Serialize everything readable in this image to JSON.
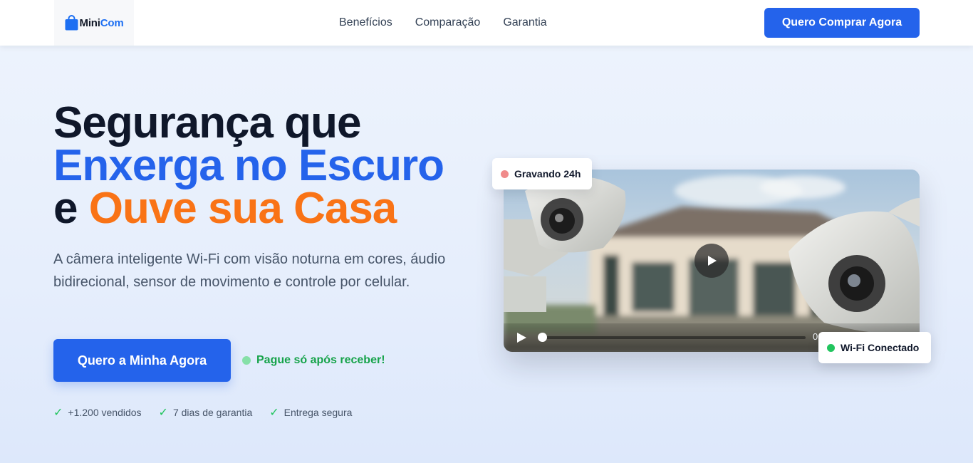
{
  "brand": {
    "name_part1": "Mini",
    "name_part2": "Com",
    "icon": "shopping-bag-icon",
    "color": "#1d6ff2"
  },
  "nav": {
    "items": [
      {
        "label": "Benefícios"
      },
      {
        "label": "Comparação"
      },
      {
        "label": "Garantia"
      }
    ],
    "cta_label": "Quero Comprar Agora"
  },
  "hero": {
    "headline_line1": "Segurança que",
    "headline_line2": "Enxerga no Escuro",
    "headline_line3_prefix": "e ",
    "headline_line3_highlight": "Ouve sua Casa",
    "subtext": "A câmera inteligente Wi-Fi com visão noturna em cores, áudio bidirecional, sensor de movimento e controle por celular.",
    "cta_label": "Quero a Minha Agora",
    "pay_note": "Pague só após receber!",
    "trust": [
      {
        "icon": "check-icon",
        "label": "+1.200 vendidos"
      },
      {
        "icon": "check-icon",
        "label": "7 dias de garantia"
      },
      {
        "icon": "check-icon",
        "label": "Entrega segura"
      }
    ]
  },
  "video": {
    "recording_badge": "Gravando 24h",
    "wifi_badge": "Wi-Fi Conectado",
    "time_label": "0",
    "progress": 0
  },
  "colors": {
    "primary": "#2463eb",
    "headline_blue": "#2563eb",
    "headline_orange": "#f97316",
    "success_green": "#16a34a",
    "recording_red": "#f08a8a"
  }
}
